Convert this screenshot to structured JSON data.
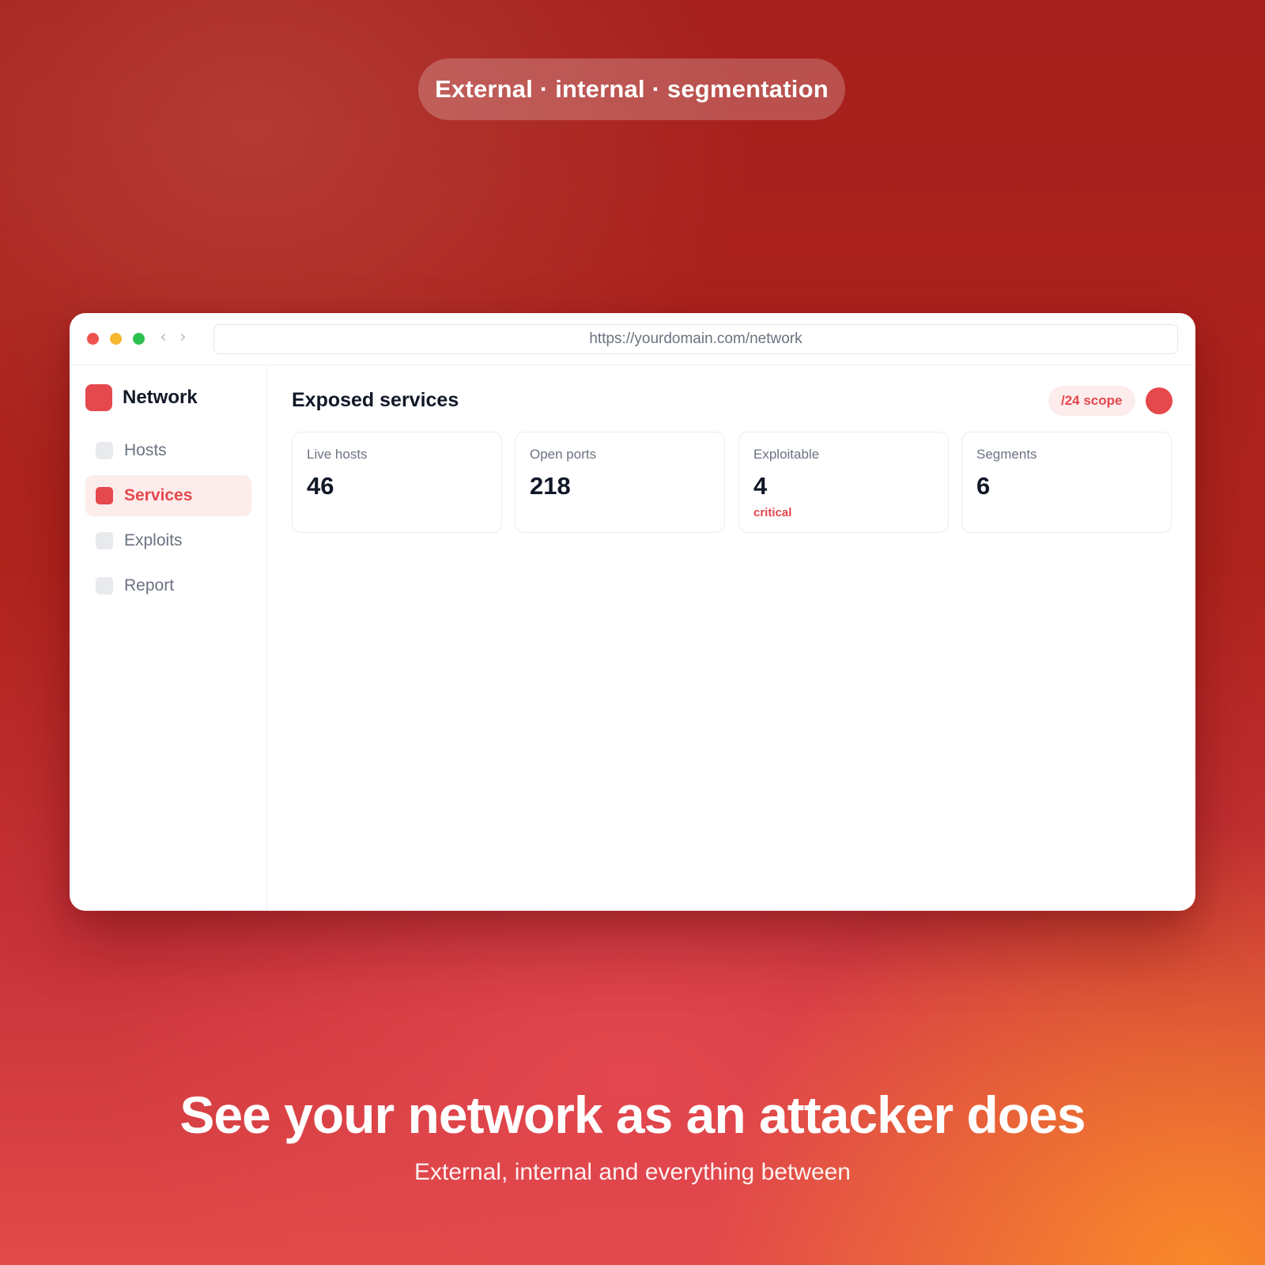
{
  "hero": {
    "pill_text": "External · internal · segmentation",
    "headline": "See your network as an attacker does",
    "subheadline": "External, internal and everything between"
  },
  "browser": {
    "url": "https://yourdomain.com/network",
    "back_icon": "‹",
    "forward_icon": "›"
  },
  "sidebar": {
    "brand": "Network",
    "items": [
      {
        "label": "Hosts",
        "active": false
      },
      {
        "label": "Services",
        "active": true
      },
      {
        "label": "Exploits",
        "active": false
      },
      {
        "label": "Report",
        "active": false
      }
    ]
  },
  "main": {
    "title": "Exposed services",
    "scope_badge": "/24 scope",
    "stats": [
      {
        "label": "Live hosts",
        "value": "46",
        "note": ""
      },
      {
        "label": "Open ports",
        "value": "218",
        "note": ""
      },
      {
        "label": "Exploitable",
        "value": "4",
        "note": "critical"
      },
      {
        "label": "Segments",
        "value": "6",
        "note": ""
      }
    ]
  },
  "colors": {
    "accent": "#e5484d",
    "accent_soft": "#fdecec",
    "text_dark": "#111827",
    "text_muted": "#6b7280"
  }
}
